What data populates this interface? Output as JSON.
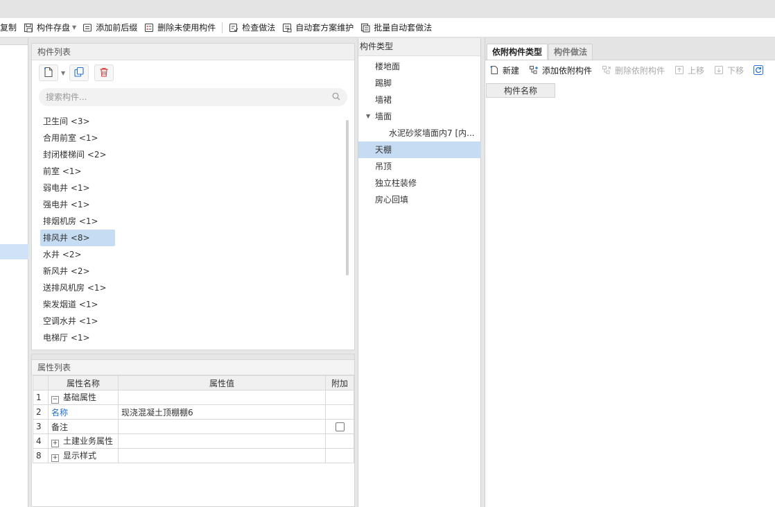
{
  "toolbar": {
    "copy_label": "复制",
    "save_label": "构件存盘",
    "prefix_label": "添加前后缀",
    "delete_unused_label": "删除未使用构件",
    "check_label": "检查做法",
    "auto_scheme_label": "自动套方案维护",
    "batch_auto_label": "批量自动套做法"
  },
  "component_list": {
    "title": "构件列表",
    "search_placeholder": "搜索构件...",
    "items": [
      {
        "label": "卫生间 <3>"
      },
      {
        "label": "合用前室 <1>"
      },
      {
        "label": "封闭楼梯间 <2>"
      },
      {
        "label": "前室 <1>"
      },
      {
        "label": "弱电井 <1>"
      },
      {
        "label": "强电井 <1>"
      },
      {
        "label": "排烟机房 <1>"
      },
      {
        "label": "排风井 <8>"
      },
      {
        "label": "水井 <2>"
      },
      {
        "label": "新风井 <2>"
      },
      {
        "label": "送排风机房 <1>"
      },
      {
        "label": "柴发烟道 <1>"
      },
      {
        "label": "空调水井 <1>"
      },
      {
        "label": "电梯厅 <1>"
      }
    ],
    "selected_index": 7
  },
  "property_list": {
    "title": "属性列表",
    "headers": {
      "name": "属性名称",
      "value": "属性值",
      "extra": "附加"
    },
    "rows": [
      {
        "num": "1",
        "name": "基础属性",
        "value": "",
        "expander": "−"
      },
      {
        "num": "2",
        "name": "名称",
        "value": "现浇混凝土顶棚棚6"
      },
      {
        "num": "3",
        "name": "备注",
        "value": ""
      },
      {
        "num": "4",
        "name": "土建业务属性",
        "value": "",
        "expander": "+"
      },
      {
        "num": "8",
        "name": "显示样式",
        "value": "",
        "expander": "+"
      }
    ]
  },
  "component_types": {
    "title": "构件类型",
    "items": [
      {
        "label": "楼地面"
      },
      {
        "label": "踢脚"
      },
      {
        "label": "墙裙"
      },
      {
        "label": "墙面"
      },
      {
        "label": "水泥砂浆墙面内7 [内..."
      },
      {
        "label": "天棚"
      },
      {
        "label": "吊顶"
      },
      {
        "label": "独立柱装修"
      },
      {
        "label": "房心回填"
      }
    ],
    "selected_index": 5
  },
  "right_panel": {
    "tabs": [
      {
        "label": "依附构件类型"
      },
      {
        "label": "构件做法"
      }
    ],
    "toolbar": {
      "new_label": "新建",
      "add_label": "添加依附构件",
      "delete_label": "删除依附构件",
      "up_label": "上移",
      "down_label": "下移"
    },
    "grid_header": "构件名称"
  },
  "colors": {
    "selection": "#c5dcf2",
    "link_blue": "#1f6fd0",
    "disabled": "#aaaaaa"
  }
}
